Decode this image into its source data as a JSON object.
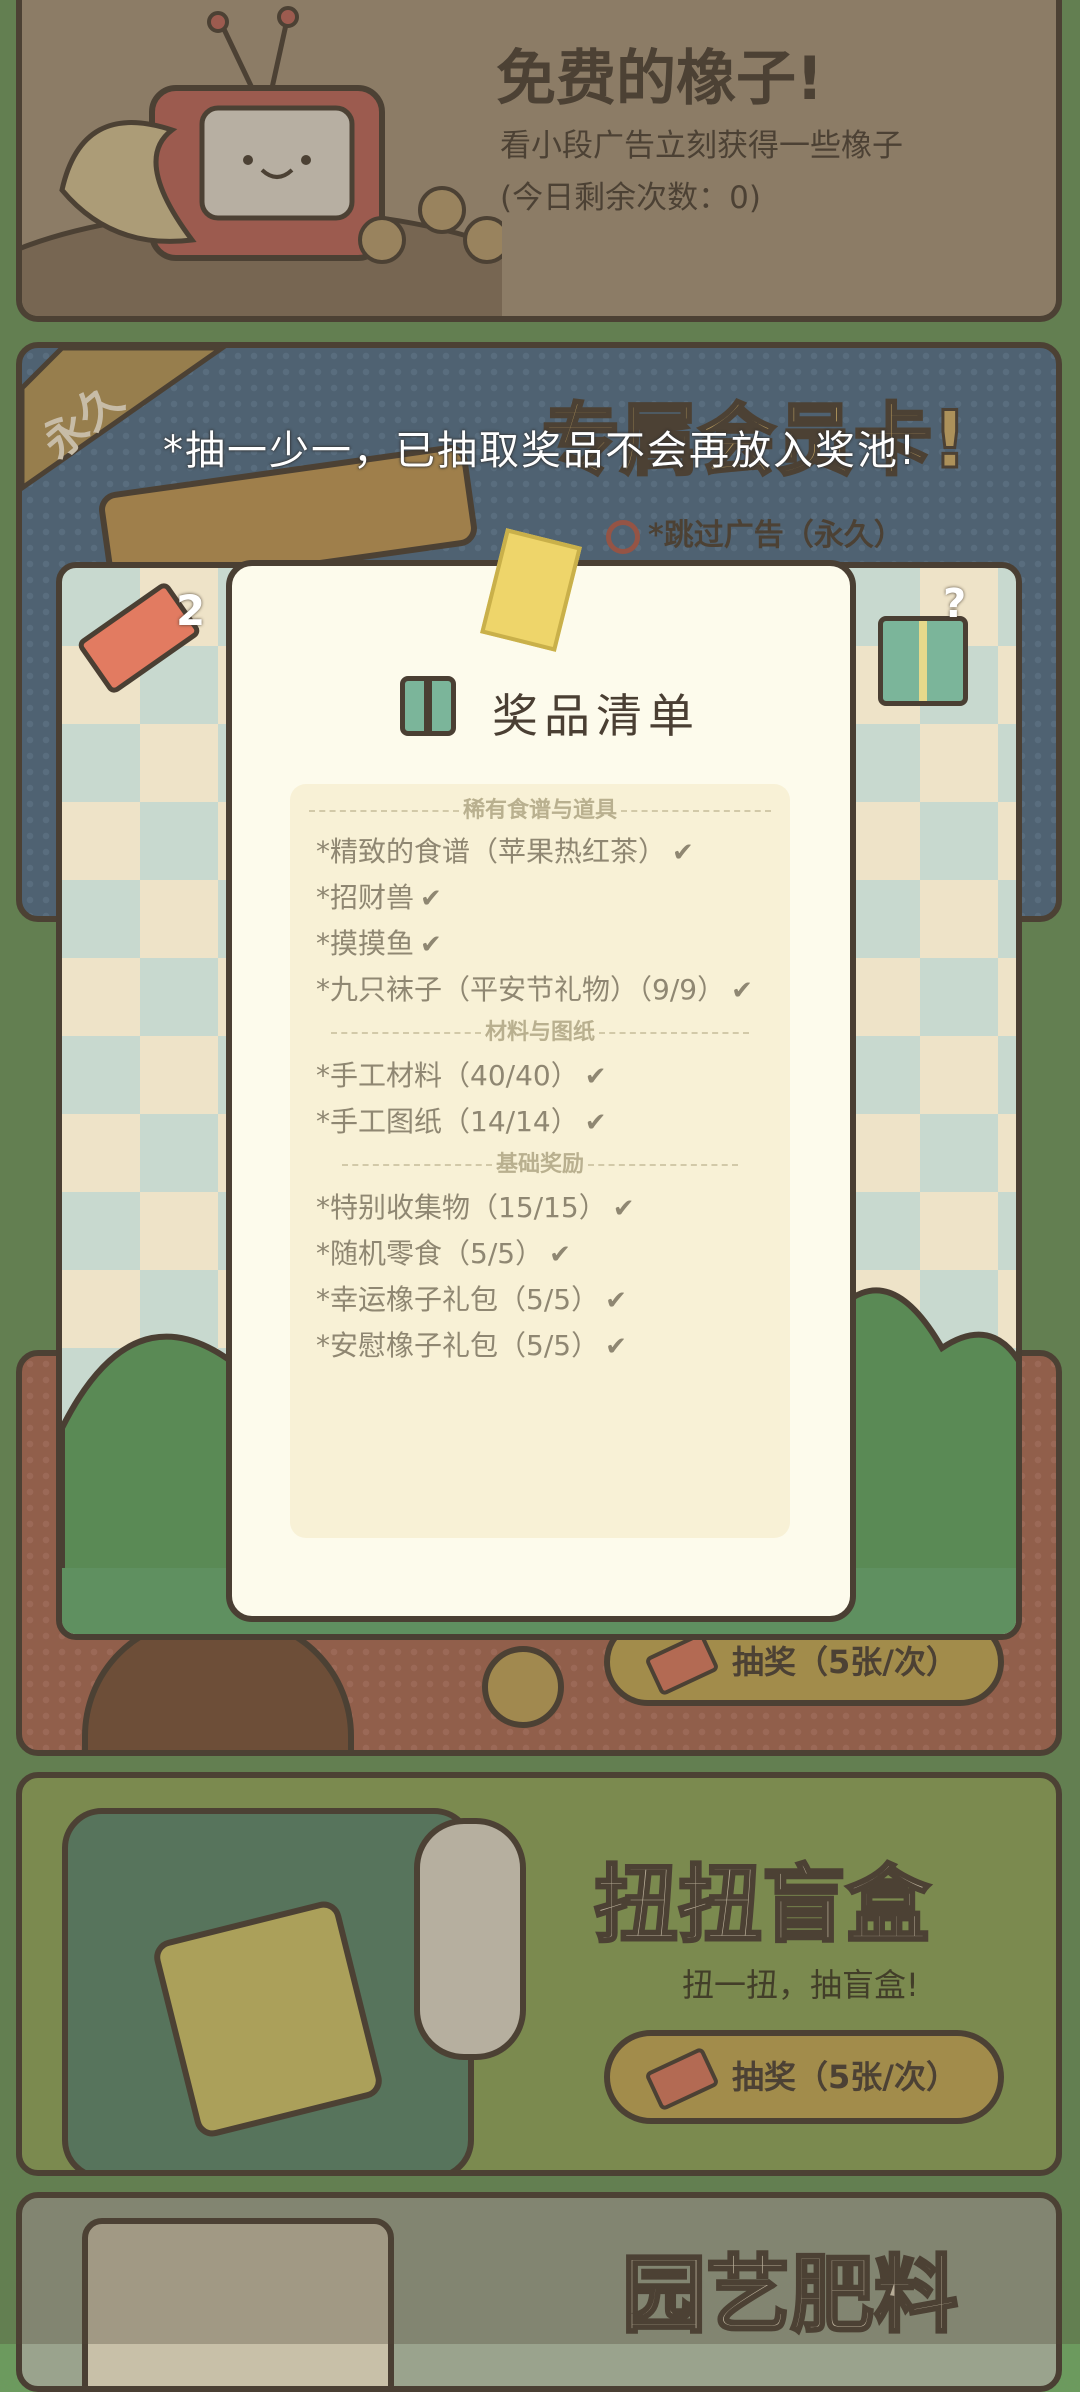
{
  "free_acorns": {
    "title": "免费的橡子!",
    "desc": "看小段广告立刻获得一些橡子",
    "remaining": "(今日剩余次数：0)"
  },
  "membership": {
    "ribbon": "永久",
    "title": "专属会员卡!",
    "skip_ads": "*跳过广告（永久）"
  },
  "notice": "*抽一少一，已抽取奖品不会再放入奖池!",
  "ticket_count": "2",
  "prize_list": {
    "title": "奖品清单",
    "sections": [
      {
        "header": "稀有食谱与道具",
        "items": [
          "*精致的食谱（苹果热红茶）",
          "*招财兽",
          "*摸摸鱼",
          "*九只袜子（平安节礼物）（9/9）"
        ]
      },
      {
        "header": "材料与图纸",
        "items": [
          "*手工材料（40/40）",
          "*手工图纸（14/14）"
        ]
      },
      {
        "header": "基础奖励",
        "items": [
          "*特别收集物（15/15）",
          "*随机零食（5/5）",
          "*幸运橡子礼包（5/5）",
          "*安慰橡子礼包（5/5）"
        ]
      }
    ]
  },
  "lottery_card": {
    "button": "抽奖（5张/次）"
  },
  "gacha": {
    "title": "扭扭盲盒",
    "desc": "扭一扭，抽盲盒!",
    "button": "抽奖（5张/次）"
  },
  "garden": {
    "title": "园艺肥料"
  },
  "icons": {
    "check": "check-icon",
    "gift": "gift-icon",
    "ticket": "ticket-icon",
    "no_ads": "no-ads-icon"
  },
  "colors": {
    "outline": "#4a3f33",
    "button": "#c9ad55",
    "paper": "#fdfbec"
  }
}
